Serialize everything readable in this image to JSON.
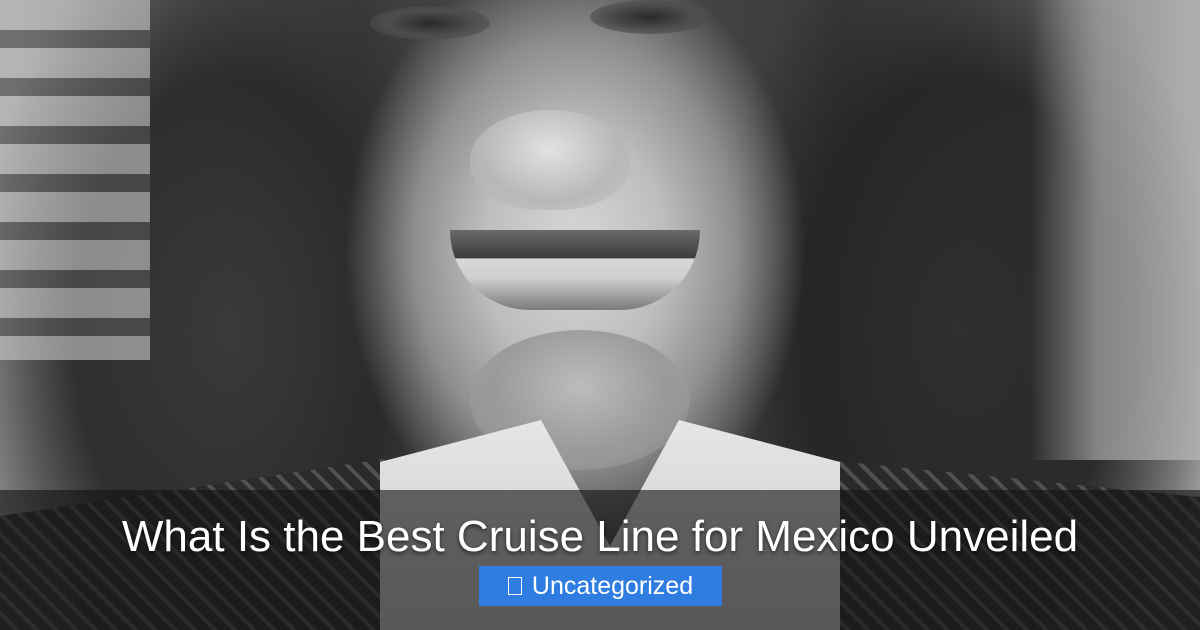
{
  "post": {
    "title": "What Is the Best Cruise Line for Mexico Unveiled",
    "category_label": "Uncategorized",
    "category_icon": "folder-icon"
  },
  "colors": {
    "badge_background": "#2f7de1",
    "overlay": "rgba(20,20,20,0.62)",
    "title_text": "#ffffff"
  }
}
